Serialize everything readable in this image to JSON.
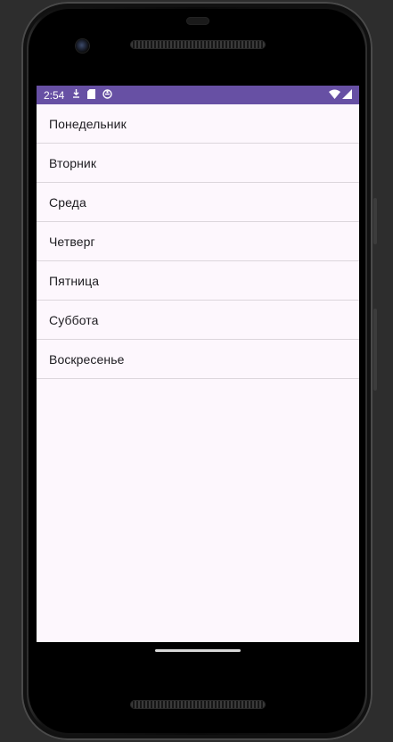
{
  "status_bar": {
    "time": "2:54",
    "left_icons": [
      "download-icon",
      "sd-card-icon",
      "sync-icon"
    ],
    "right_icons": [
      "wifi-icon",
      "cell-signal-icon"
    ],
    "color": "#6750a4"
  },
  "list": {
    "items": [
      {
        "label": "Понедельник"
      },
      {
        "label": "Вторник"
      },
      {
        "label": "Среда"
      },
      {
        "label": "Четверг"
      },
      {
        "label": "Пятница"
      },
      {
        "label": "Суббота"
      },
      {
        "label": "Воскресенье"
      }
    ]
  },
  "colors": {
    "background": "#fdf7fd",
    "divider": "#dcd6dc",
    "text": "#1c1b1f"
  }
}
